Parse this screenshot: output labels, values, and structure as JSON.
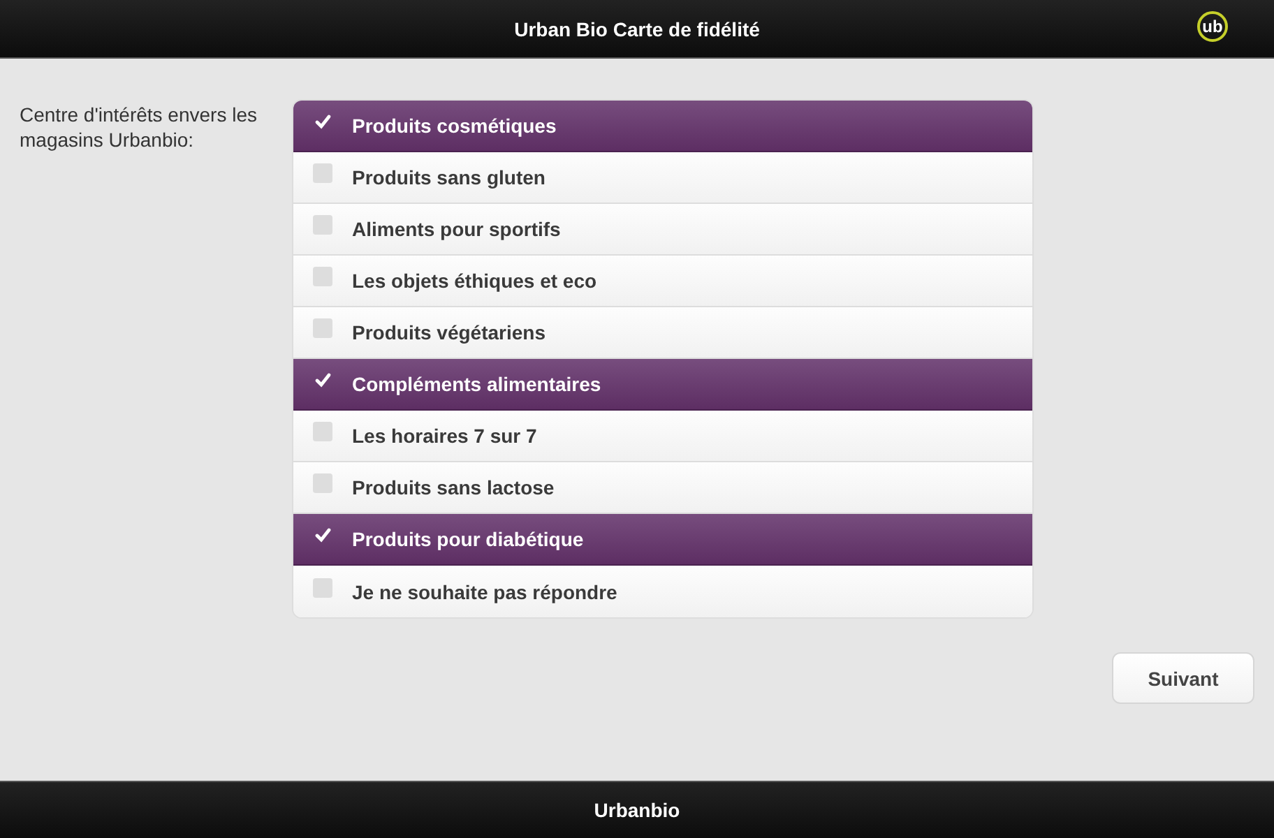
{
  "header": {
    "title": "Urban Bio Carte de fidélité",
    "logo": "ub"
  },
  "question": {
    "label": "Centre d'intérêts envers les magasins Urbanbio:"
  },
  "options": [
    {
      "label": "Produits cosmétiques",
      "checked": true
    },
    {
      "label": "Produits sans gluten",
      "checked": false
    },
    {
      "label": "Aliments pour sportifs",
      "checked": false
    },
    {
      "label": "Les objets éthiques et eco",
      "checked": false
    },
    {
      "label": "Produits végétariens",
      "checked": false
    },
    {
      "label": "Compléments alimentaires",
      "checked": true
    },
    {
      "label": "Les horaires 7 sur 7",
      "checked": false
    },
    {
      "label": "Produits sans lactose",
      "checked": false
    },
    {
      "label": "Produits pour diabétique",
      "checked": true
    },
    {
      "label": "Je ne souhaite pas répondre",
      "checked": false
    }
  ],
  "next_button": "Suivant",
  "footer": {
    "title": "Urbanbio"
  }
}
